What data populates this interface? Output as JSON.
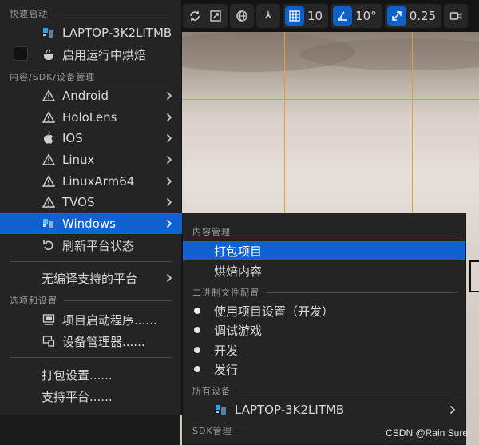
{
  "toolbar": {
    "values": {
      "grid": "10",
      "angle": "10°",
      "scale": "0.25"
    }
  },
  "menu": {
    "sections": {
      "quick_launch": "快速启动",
      "content_sdk": "内容/SDK/设备管理",
      "options": "选项和设置"
    },
    "quick_items": [
      {
        "label": "LAPTOP-3K2LITMB",
        "icon": "windows-device-icon"
      },
      {
        "label": "启用运行中烘焙",
        "icon": "cook-icon"
      }
    ],
    "platforms": [
      {
        "label": "Android",
        "icon": "warning-icon"
      },
      {
        "label": "HoloLens",
        "icon": "warning-icon"
      },
      {
        "label": "IOS",
        "icon": "apple-icon"
      },
      {
        "label": "Linux",
        "icon": "warning-icon"
      },
      {
        "label": "LinuxArm64",
        "icon": "warning-icon"
      },
      {
        "label": "TVOS",
        "icon": "warning-icon"
      },
      {
        "label": "Windows",
        "icon": "windows-device-icon"
      },
      {
        "label": "刷新平台状态",
        "icon": "refresh-icon"
      }
    ],
    "no_compile": "无编译支持的平台",
    "options_items": [
      {
        "label": "项目启动程序......",
        "icon": "launcher-icon"
      },
      {
        "label": "设备管理器......",
        "icon": "device-manager-icon"
      }
    ],
    "bottom_items": [
      "打包设置......",
      "支持平台......"
    ]
  },
  "submenu": {
    "sections": {
      "content": "内容管理",
      "binary": "二进制文件配置",
      "devices": "所有设备",
      "sdk": "SDK管理"
    },
    "content_items": [
      "打包项目",
      "烘焙内容"
    ],
    "binary_items": [
      "使用项目设置（开发）",
      "调试游戏",
      "开发",
      "发行"
    ],
    "device_item": "LAPTOP-3K2LITMB"
  },
  "watermark": "CSDN @Rain Sure",
  "colors": {
    "highlight": "#0f62cf",
    "menu_bg": "#242424",
    "grid_line": "#e6a21e"
  }
}
